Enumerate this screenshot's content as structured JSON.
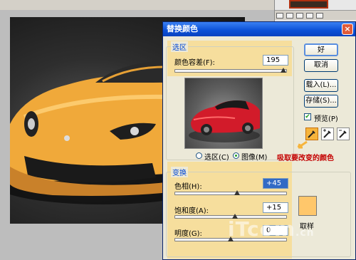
{
  "dialog": {
    "title": "替换颜色",
    "close_glyph": "×",
    "selection": {
      "group_label": "选区",
      "fuzziness_label": "颜色容差(F):",
      "fuzziness_value": "195",
      "fuzziness_level": 0.97,
      "radio_selection": "选区(C)",
      "radio_image": "图像(M)",
      "selected_radio": "image"
    },
    "buttons": {
      "ok": "好",
      "cancel": "取消",
      "load": "载入(L)...",
      "save": "存储(S)..."
    },
    "preview": {
      "label": "预览(P)",
      "checked": true
    },
    "annotation": "吸取要改变的颜色",
    "transform": {
      "group_label": "变换",
      "hue_label": "色相(H):",
      "hue_value": "+45",
      "hue_level": 0.56,
      "saturation_label": "饱和度(A):",
      "saturation_value": "+15",
      "saturation_level": 0.54,
      "lightness_label": "明度(G):",
      "lightness_value": "0",
      "lightness_level": 0.5,
      "sample_label": "取样",
      "sample_color": "#ffc76b"
    }
  },
  "watermark": {
    "main": "iTcom",
    "suffix": ".cn"
  },
  "colors": {
    "accent": "#0a4fd6",
    "highlight": "#ffd66e",
    "annotation": "#c40000",
    "car": "#f0a93a"
  }
}
